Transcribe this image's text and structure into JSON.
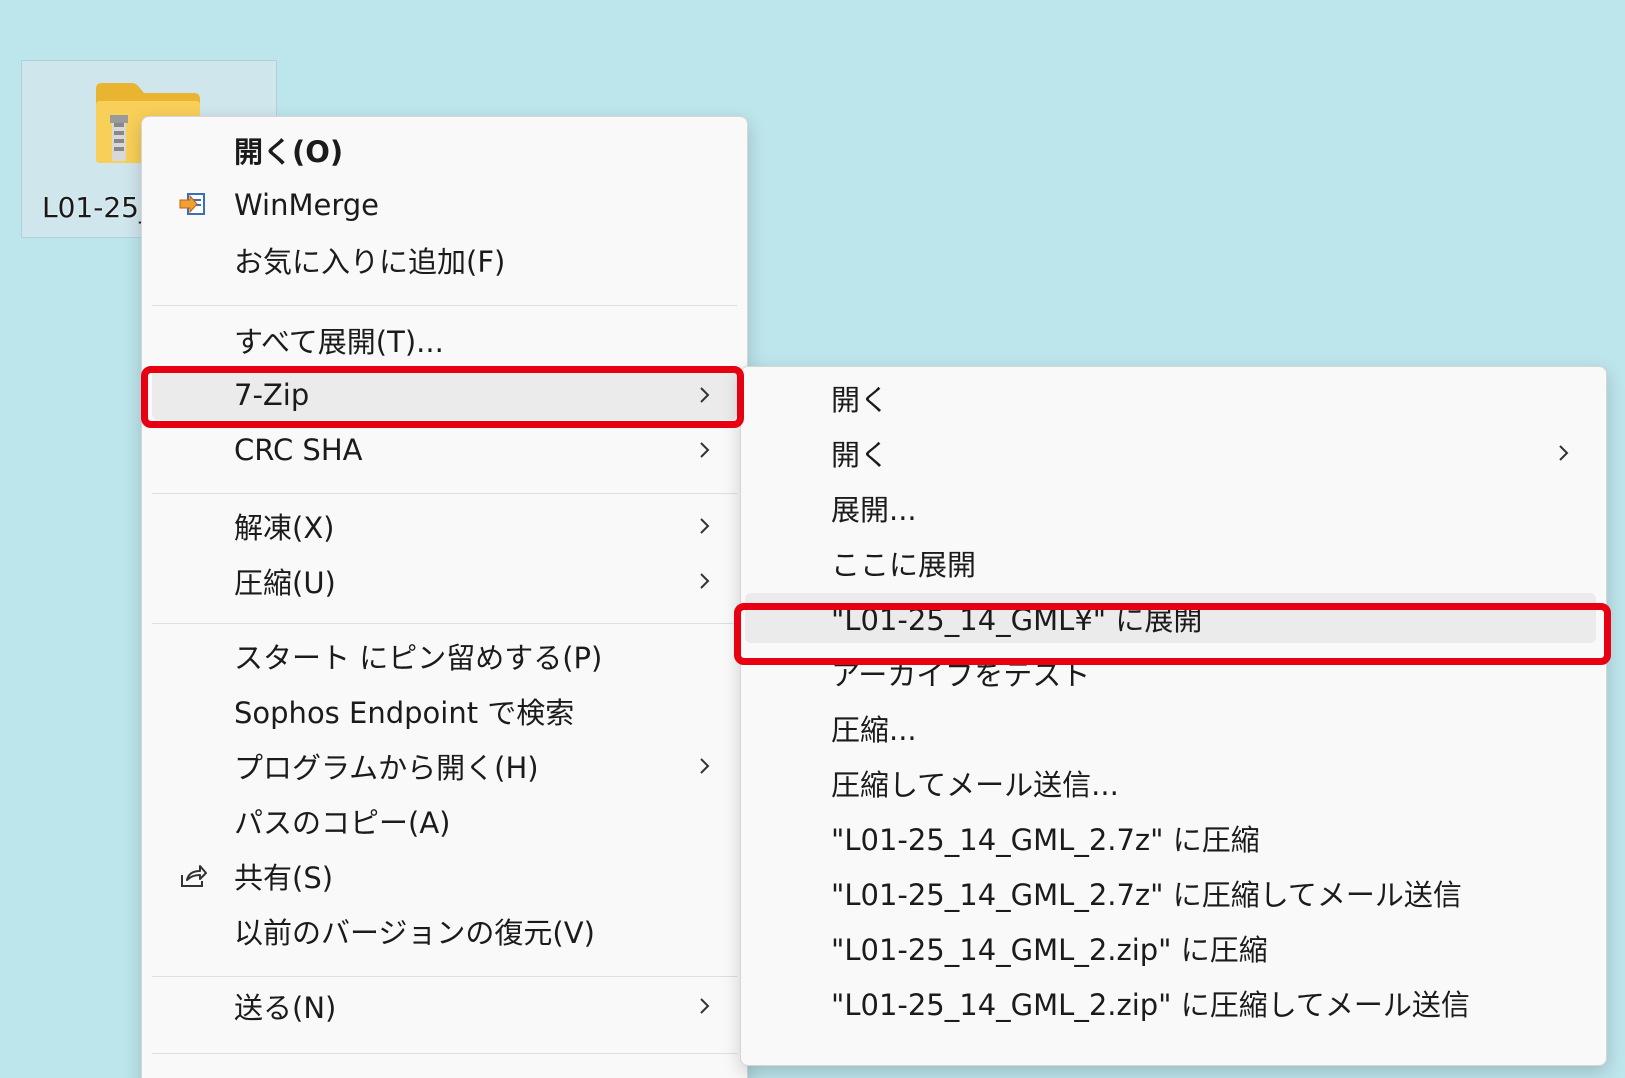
{
  "desktop": {
    "file_label": "L01-25_"
  },
  "main_menu": {
    "items": [
      {
        "label": "開く(O)"
      },
      {
        "label": "WinMerge"
      },
      {
        "label": "お気に入りに追加(F)"
      },
      {
        "label": "すべて展開(T)..."
      },
      {
        "label": "7-Zip"
      },
      {
        "label": "CRC SHA"
      },
      {
        "label": "解凍(X)"
      },
      {
        "label": "圧縮(U)"
      },
      {
        "label": "スタート にピン留めする(P)"
      },
      {
        "label": "Sophos Endpoint で検索"
      },
      {
        "label": "プログラムから開く(H)"
      },
      {
        "label": "パスのコピー(A)"
      },
      {
        "label": "共有(S)"
      },
      {
        "label": "以前のバージョンの復元(V)"
      },
      {
        "label": "送る(N)"
      }
    ]
  },
  "submenu_7zip": {
    "items": [
      {
        "label": "開く"
      },
      {
        "label": "開く"
      },
      {
        "label": "展開..."
      },
      {
        "label": "ここに展開"
      },
      {
        "label": "\"L01-25_14_GML¥\" に展開"
      },
      {
        "label": "アーカイブをテスト"
      },
      {
        "label": "圧縮..."
      },
      {
        "label": "圧縮してメール送信..."
      },
      {
        "label": "\"L01-25_14_GML_2.7z\" に圧縮"
      },
      {
        "label": "\"L01-25_14_GML_2.7z\" に圧縮してメール送信"
      },
      {
        "label": "\"L01-25_14_GML_2.zip\" に圧縮"
      },
      {
        "label": "\"L01-25_14_GML_2.zip\" に圧縮してメール送信"
      }
    ]
  },
  "icons": {
    "folder": "zip-folder-icon",
    "winmerge": "winmerge-icon",
    "share": "share-icon",
    "chevron": "chevron-right-icon"
  },
  "colors": {
    "desktop_bg": "#bde5ec",
    "menu_bg": "#f9f9f9",
    "hover_bg": "#ebebeb",
    "highlight": "#e60012",
    "folder": "#f8c94a"
  }
}
